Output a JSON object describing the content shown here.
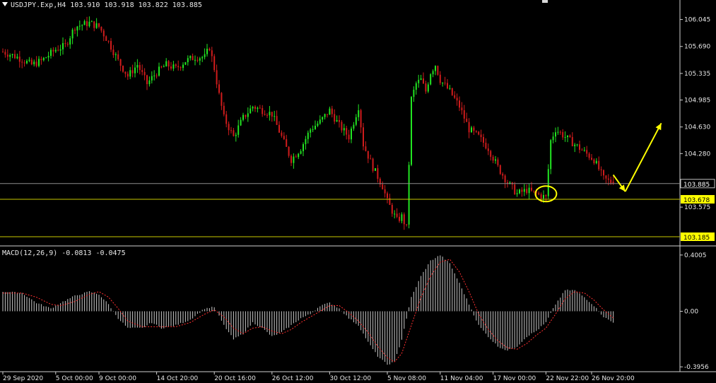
{
  "header": {
    "symbol_line": "USDJPY.Exp,H4  103.910 103.918 103.822 103.885",
    "macd_line": "MACD(12,26,9) -0.0813 -0.0475"
  },
  "colors": {
    "background": "#000000",
    "bull": "#22e622",
    "bear": "#d01c1c",
    "level_line": "#c8c800",
    "annotation": "#ffff00",
    "price_line": "#8c8c8c",
    "histogram": "#c8c8c8",
    "signal": "#ff3030",
    "axis_text": "#e6e6e6"
  },
  "chart_data": [
    {
      "type": "candlestick",
      "symbol": "USDJPY.Exp",
      "timeframe": "H4",
      "ohlc_header": {
        "open": 103.91,
        "high": 103.918,
        "low": 103.822,
        "close": 103.885
      },
      "ylim": [
        103.12,
        106.19
      ],
      "y_ticks": [
        "106.045",
        "105.690",
        "105.335",
        "104.985",
        "104.630",
        "104.280",
        "103.575"
      ],
      "y_tick_values": [
        106.045,
        105.69,
        105.335,
        104.985,
        104.63,
        104.28,
        103.575
      ],
      "x_ticks": [
        "29 Sep 2020",
        "5 Oct 00:00",
        "9 Oct 00:00",
        "14 Oct 20:00",
        "20 Oct 16:00",
        "26 Oct 12:00",
        "30 Oct 12:00",
        "5 Nov 08:00",
        "11 Nov 04:00",
        "17 Nov 00:00",
        "22 Nov 22:00",
        "26 Nov 20:00"
      ],
      "x_tick_index": [
        0,
        22,
        40,
        64,
        88,
        112,
        136,
        160,
        182,
        204,
        226,
        245
      ],
      "close_path": [
        [
          0,
          105.62
        ],
        [
          6,
          105.55
        ],
        [
          12,
          105.45
        ],
        [
          16,
          105.5
        ],
        [
          22,
          105.65
        ],
        [
          26,
          105.7
        ],
        [
          30,
          105.95
        ],
        [
          36,
          106.0
        ],
        [
          40,
          105.95
        ],
        [
          44,
          105.75
        ],
        [
          48,
          105.5
        ],
        [
          52,
          105.3
        ],
        [
          56,
          105.45
        ],
        [
          60,
          105.2
        ],
        [
          64,
          105.35
        ],
        [
          68,
          105.45
        ],
        [
          72,
          105.4
        ],
        [
          76,
          105.5
        ],
        [
          80,
          105.55
        ],
        [
          84,
          105.55
        ],
        [
          86,
          105.68
        ],
        [
          88,
          105.4
        ],
        [
          90,
          105.05
        ],
        [
          92,
          104.75
        ],
        [
          96,
          104.5
        ],
        [
          100,
          104.75
        ],
        [
          104,
          104.9
        ],
        [
          108,
          104.85
        ],
        [
          112,
          104.8
        ],
        [
          116,
          104.5
        ],
        [
          120,
          104.2
        ],
        [
          124,
          104.35
        ],
        [
          128,
          104.6
        ],
        [
          132,
          104.7
        ],
        [
          136,
          104.85
        ],
        [
          140,
          104.65
        ],
        [
          144,
          104.5
        ],
        [
          148,
          104.9
        ],
        [
          150,
          104.4
        ],
        [
          154,
          104.1
        ],
        [
          158,
          103.85
        ],
        [
          160,
          103.65
        ],
        [
          164,
          103.4
        ],
        [
          166,
          103.45
        ],
        [
          168,
          103.3
        ],
        [
          170,
          105.0
        ],
        [
          172,
          105.2
        ],
        [
          174,
          105.25
        ],
        [
          176,
          105.1
        ],
        [
          178,
          105.35
        ],
        [
          180,
          105.45
        ],
        [
          182,
          105.25
        ],
        [
          186,
          105.1
        ],
        [
          190,
          104.9
        ],
        [
          194,
          104.6
        ],
        [
          198,
          104.5
        ],
        [
          202,
          104.35
        ],
        [
          206,
          104.1
        ],
        [
          210,
          103.9
        ],
        [
          214,
          103.75
        ],
        [
          218,
          103.8
        ],
        [
          222,
          103.75
        ],
        [
          226,
          103.7
        ],
        [
          228,
          104.45
        ],
        [
          230,
          104.6
        ],
        [
          234,
          104.5
        ],
        [
          238,
          104.4
        ],
        [
          242,
          104.3
        ],
        [
          246,
          104.2
        ],
        [
          250,
          103.95
        ],
        [
          254,
          103.885
        ]
      ],
      "levels": [
        103.885,
        103.678,
        103.185
      ],
      "level_labels": [
        "103.885",
        "103.678",
        "103.185"
      ],
      "annotations": {
        "circle_at": {
          "index": 226,
          "price": 103.75
        },
        "arrow_down": {
          "from": [
            254,
            104.0
          ],
          "to": [
            259,
            103.78
          ]
        },
        "arrow_up": {
          "from": [
            259,
            103.78
          ],
          "to": [
            274,
            104.68
          ]
        }
      }
    },
    {
      "type": "bar",
      "indicator": "MACD(12,26,9)",
      "macd": -0.0813,
      "signal": -0.0475,
      "ylim": [
        -0.4,
        0.405
      ],
      "y_ticks": [
        "0.4005",
        "0.00",
        "-0.3956"
      ],
      "y_tick_values": [
        0.4005,
        0.0,
        -0.3956
      ],
      "hist_path": [
        [
          0,
          0.14
        ],
        [
          8,
          0.13
        ],
        [
          14,
          0.06
        ],
        [
          20,
          0.02
        ],
        [
          24,
          0.06
        ],
        [
          30,
          0.11
        ],
        [
          36,
          0.14
        ],
        [
          40,
          0.12
        ],
        [
          44,
          0.05
        ],
        [
          48,
          -0.05
        ],
        [
          52,
          -0.12
        ],
        [
          58,
          -0.12
        ],
        [
          62,
          -0.08
        ],
        [
          66,
          -0.12
        ],
        [
          72,
          -0.1
        ],
        [
          78,
          -0.06
        ],
        [
          84,
          0.02
        ],
        [
          88,
          0.03
        ],
        [
          92,
          -0.1
        ],
        [
          96,
          -0.2
        ],
        [
          100,
          -0.16
        ],
        [
          104,
          -0.08
        ],
        [
          108,
          -0.12
        ],
        [
          112,
          -0.18
        ],
        [
          116,
          -0.15
        ],
        [
          120,
          -0.1
        ],
        [
          124,
          -0.05
        ],
        [
          128,
          -0.02
        ],
        [
          132,
          0.04
        ],
        [
          136,
          0.06
        ],
        [
          140,
          0.02
        ],
        [
          144,
          -0.05
        ],
        [
          148,
          -0.1
        ],
        [
          152,
          -0.22
        ],
        [
          156,
          -0.32
        ],
        [
          160,
          -0.38
        ],
        [
          163,
          -0.36
        ],
        [
          166,
          -0.2
        ],
        [
          170,
          0.1
        ],
        [
          174,
          0.25
        ],
        [
          178,
          0.36
        ],
        [
          182,
          0.4
        ],
        [
          186,
          0.34
        ],
        [
          190,
          0.2
        ],
        [
          194,
          0.05
        ],
        [
          198,
          -0.1
        ],
        [
          202,
          -0.18
        ],
        [
          206,
          -0.25
        ],
        [
          210,
          -0.28
        ],
        [
          214,
          -0.25
        ],
        [
          218,
          -0.18
        ],
        [
          222,
          -0.14
        ],
        [
          226,
          -0.08
        ],
        [
          230,
          0.05
        ],
        [
          234,
          0.15
        ],
        [
          238,
          0.15
        ],
        [
          242,
          0.1
        ],
        [
          246,
          0.04
        ],
        [
          250,
          -0.04
        ],
        [
          254,
          -0.0813
        ]
      ],
      "signal_path": [
        [
          0,
          0.13
        ],
        [
          8,
          0.13
        ],
        [
          14,
          0.1
        ],
        [
          20,
          0.05
        ],
        [
          24,
          0.04
        ],
        [
          30,
          0.07
        ],
        [
          36,
          0.12
        ],
        [
          40,
          0.14
        ],
        [
          44,
          0.1
        ],
        [
          48,
          0.02
        ],
        [
          52,
          -0.07
        ],
        [
          58,
          -0.11
        ],
        [
          62,
          -0.11
        ],
        [
          66,
          -0.11
        ],
        [
          72,
          -0.11
        ],
        [
          78,
          -0.08
        ],
        [
          84,
          -0.02
        ],
        [
          88,
          0.01
        ],
        [
          92,
          -0.04
        ],
        [
          96,
          -0.12
        ],
        [
          100,
          -0.16
        ],
        [
          104,
          -0.12
        ],
        [
          108,
          -0.11
        ],
        [
          112,
          -0.14
        ],
        [
          116,
          -0.16
        ],
        [
          120,
          -0.13
        ],
        [
          124,
          -0.08
        ],
        [
          128,
          -0.04
        ],
        [
          132,
          0.0
        ],
        [
          136,
          0.04
        ],
        [
          140,
          0.04
        ],
        [
          144,
          -0.01
        ],
        [
          148,
          -0.07
        ],
        [
          152,
          -0.15
        ],
        [
          156,
          -0.25
        ],
        [
          160,
          -0.33
        ],
        [
          163,
          -0.36
        ],
        [
          166,
          -0.3
        ],
        [
          170,
          -0.1
        ],
        [
          174,
          0.1
        ],
        [
          178,
          0.25
        ],
        [
          182,
          0.35
        ],
        [
          186,
          0.37
        ],
        [
          190,
          0.28
        ],
        [
          194,
          0.14
        ],
        [
          198,
          -0.02
        ],
        [
          202,
          -0.13
        ],
        [
          206,
          -0.21
        ],
        [
          210,
          -0.26
        ],
        [
          214,
          -0.27
        ],
        [
          218,
          -0.23
        ],
        [
          222,
          -0.17
        ],
        [
          226,
          -0.12
        ],
        [
          230,
          -0.02
        ],
        [
          234,
          0.09
        ],
        [
          238,
          0.14
        ],
        [
          242,
          0.13
        ],
        [
          246,
          0.08
        ],
        [
          250,
          0.01
        ],
        [
          254,
          -0.0475
        ]
      ]
    }
  ]
}
